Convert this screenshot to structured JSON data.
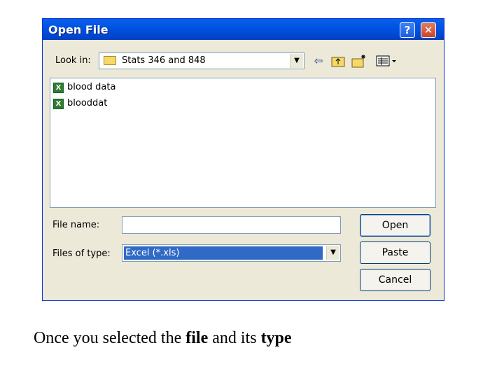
{
  "dialog": {
    "title": "Open File",
    "help_label": "?",
    "close_label": "✕",
    "look_in_label": "Look in:",
    "look_in_value": "Stats 346 and 848",
    "files": [
      {
        "name": "blood data",
        "icon": "excel-file-icon"
      },
      {
        "name": "blooddat",
        "icon": "excel-file-icon"
      }
    ],
    "file_name_label": "File name:",
    "file_name_value": "",
    "files_of_type_label": "Files of type:",
    "files_of_type_value": "Excel (*.xls)",
    "buttons": {
      "open": "Open",
      "paste": "Paste",
      "cancel": "Cancel"
    },
    "toolbar_icons": [
      "back-arrow-icon",
      "up-folder-icon",
      "new-folder-icon",
      "view-menu-icon"
    ]
  },
  "caption": {
    "part1": "Once you selected the ",
    "bold1": "file",
    "part2": " and its ",
    "bold2": "type"
  },
  "colors": {
    "titlebar": "#0054E3",
    "dialog_bg": "#ECE9D8",
    "selection": "#316AC5"
  }
}
